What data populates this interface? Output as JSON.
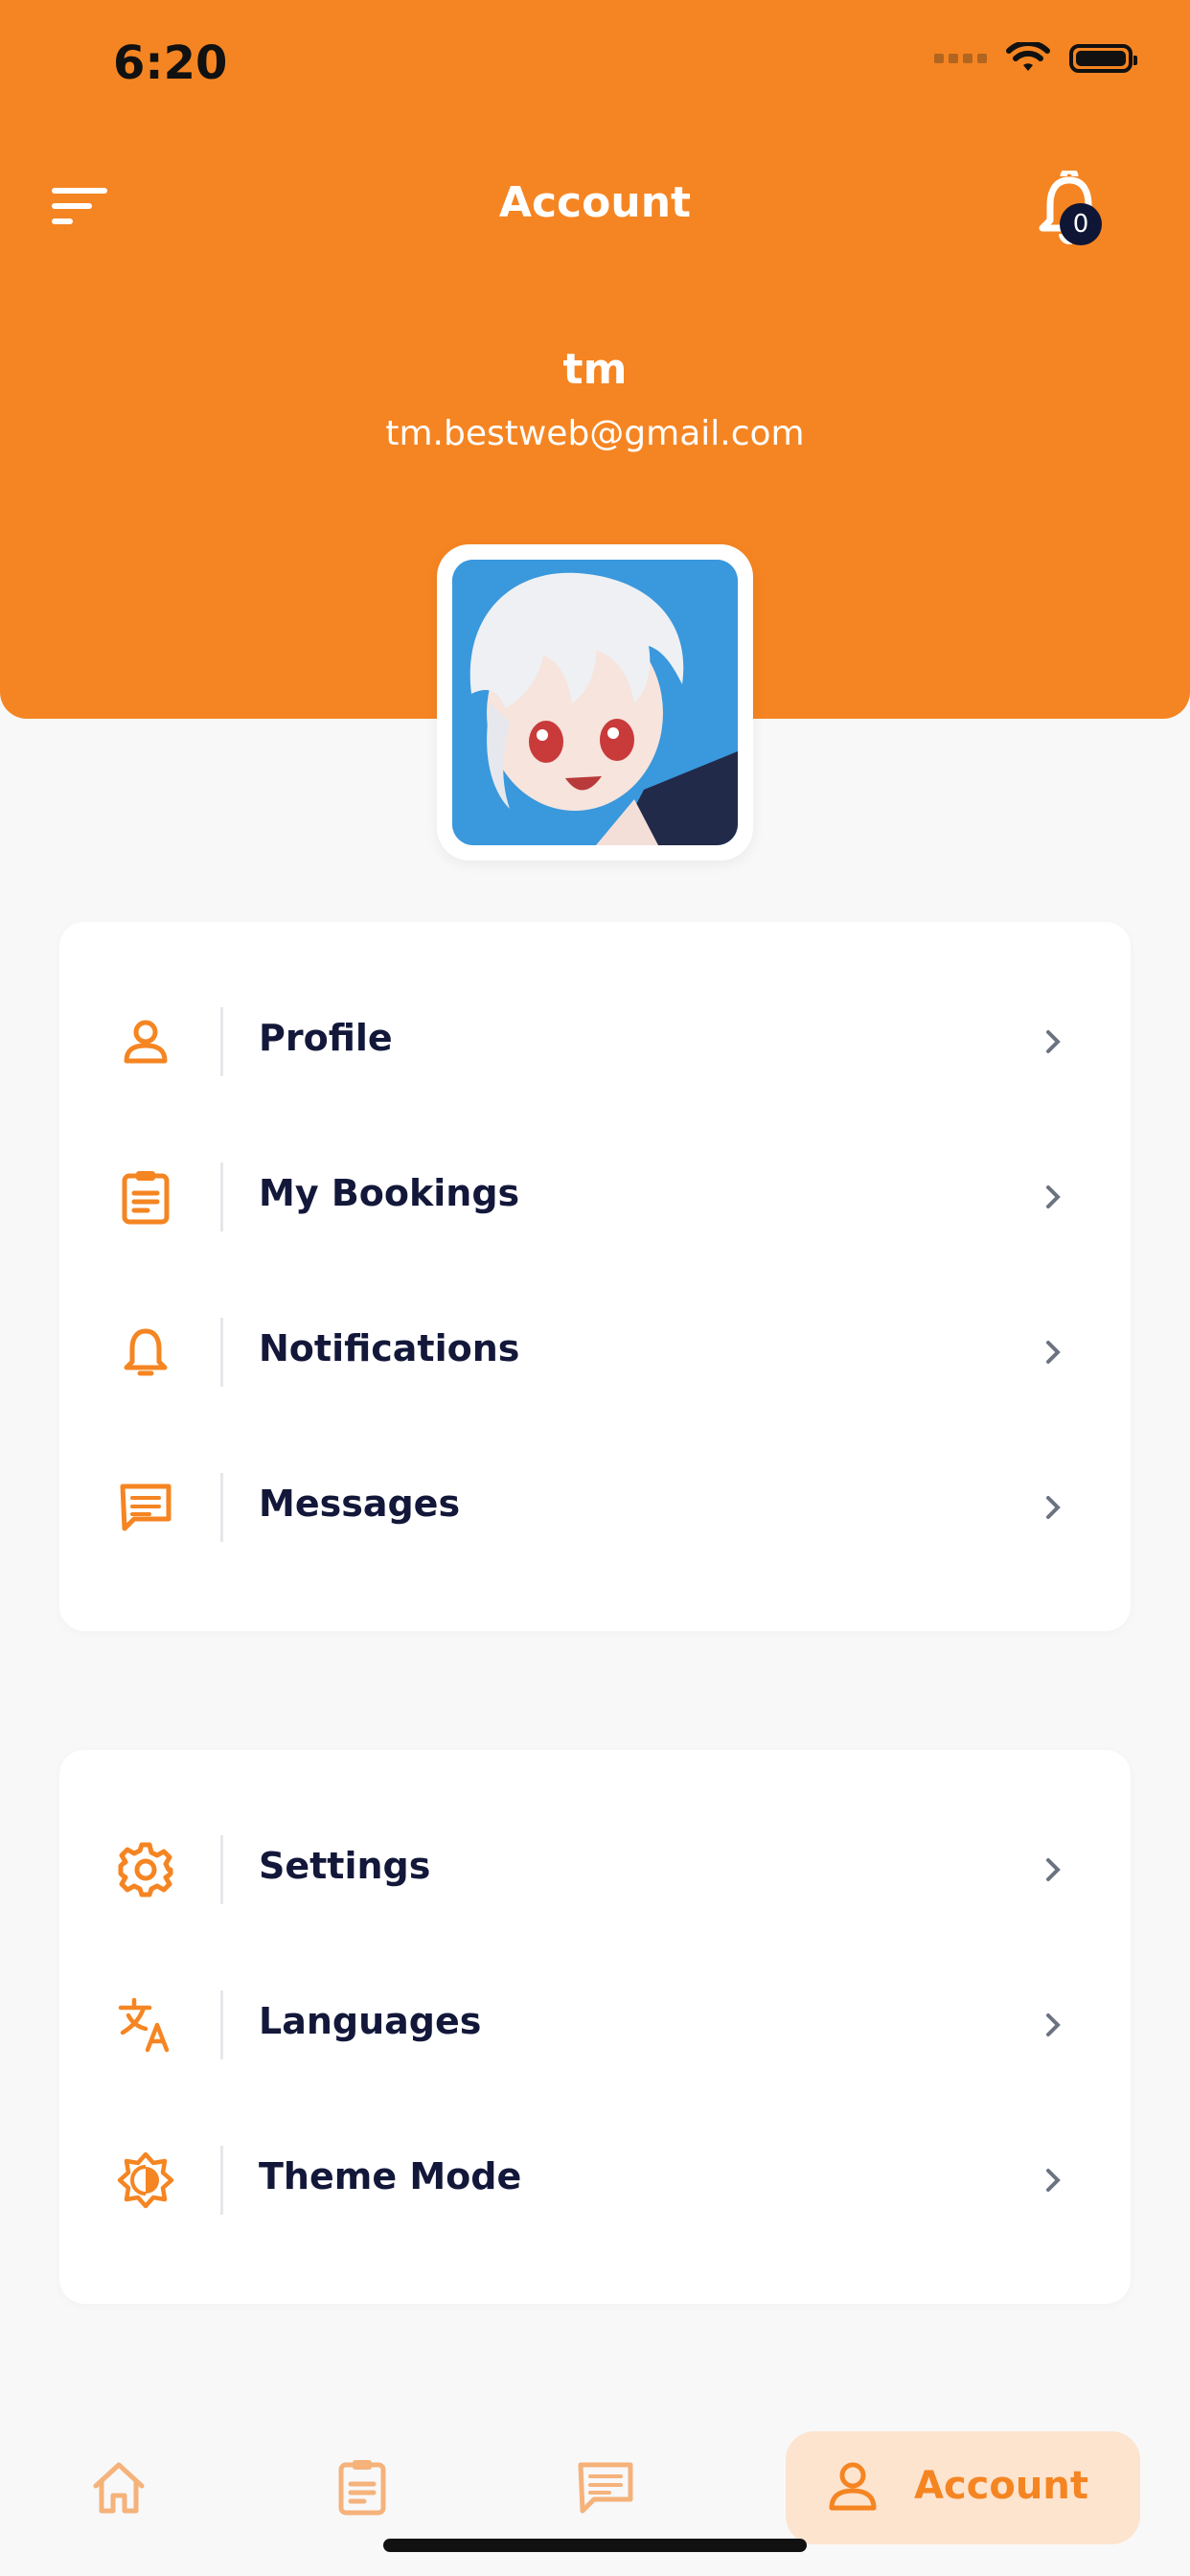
{
  "status_bar": {
    "time": "6:20"
  },
  "header": {
    "title": "Account",
    "notification_count": "0",
    "user_name": "tm",
    "user_email": "tm.bestweb@gmail.com"
  },
  "menu_group_1": [
    {
      "label": "Profile",
      "icon": "person-icon"
    },
    {
      "label": "My Bookings",
      "icon": "clipboard-icon"
    },
    {
      "label": "Notifications",
      "icon": "bell-icon"
    },
    {
      "label": "Messages",
      "icon": "message-icon"
    }
  ],
  "menu_group_2": [
    {
      "label": "Settings",
      "icon": "gear-icon"
    },
    {
      "label": "Languages",
      "icon": "translate-icon"
    },
    {
      "label": "Theme Mode",
      "icon": "brightness-icon"
    }
  ],
  "bottom_nav": {
    "items": [
      {
        "name": "home",
        "icon": "home-icon"
      },
      {
        "name": "bookings",
        "icon": "clipboard-icon"
      },
      {
        "name": "messages",
        "icon": "message-icon"
      },
      {
        "name": "account",
        "icon": "person-icon",
        "label": "Account",
        "active": true
      }
    ]
  },
  "colors": {
    "brand": "#f58522",
    "text_dark": "#13183a",
    "badge": "#0f1535",
    "active_tab_bg": "#fde4cf"
  }
}
